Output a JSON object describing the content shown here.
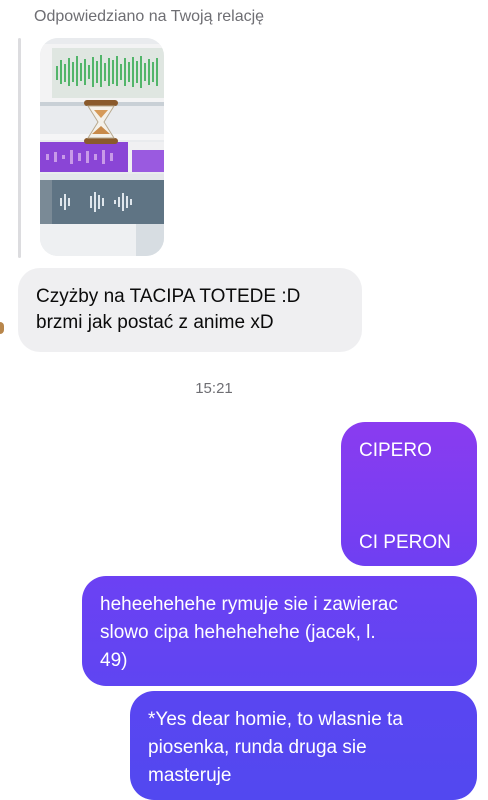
{
  "reply_header": "Odpowiedziano na Twoją relację",
  "story": {
    "icon": "hourglass-icon",
    "description_colors": {
      "green": "#52b56a",
      "purple": "#8a45d6",
      "slate": "#5f7484"
    }
  },
  "incoming": {
    "lines": [
      "Czyżby na TACIPA TOTEDE :D",
      "brzmi jak postać z anime xD"
    ]
  },
  "timestamp": "15:21",
  "outgoing": [
    {
      "lines": [
        "CIPERO",
        "CI PERON"
      ]
    },
    {
      "lines": [
        "heheehehehe rymuje sie i zawierac",
        "slowo cipa hehehehehe (jacek, l.",
        "49)"
      ]
    },
    {
      "lines": [
        "*Yes dear homie, to wlasnie ta",
        "piosenka, runda druga sie",
        "masteruje"
      ]
    }
  ],
  "colors": {
    "bubble_purple": "#8a3cf0",
    "bubble_indigo": "#5248f0",
    "incoming_bg": "#efeff1"
  }
}
